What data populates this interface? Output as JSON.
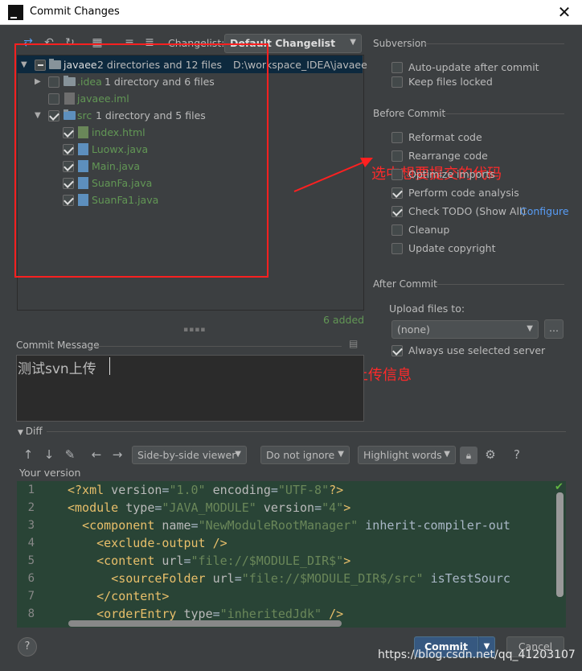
{
  "window": {
    "title": "Commit Changes",
    "close": "✕",
    "app_icon_letter": "IJ"
  },
  "toolbar": {
    "changelist_label": "Changelist:",
    "changelist_value": "Default Changelist"
  },
  "tree": {
    "root": {
      "name": "javaee",
      "detail": "2 directories and 12 files",
      "path": "D:\\workspace_IDEA\\javaee"
    },
    "idea": {
      "name": ".idea",
      "detail": "1 directory and 6 files"
    },
    "iml": {
      "name": "javaee.iml"
    },
    "src": {
      "name": "src",
      "detail": "1 directory and 5 files"
    },
    "files": [
      "index.html",
      "Luowx.java",
      "Main.java",
      "SuanFa.java",
      "SuanFa1.java"
    ],
    "added_count": "6 added"
  },
  "annotations": {
    "select_code": "选中想要提交的代码",
    "write_info": "写上上传信息"
  },
  "commit_message": {
    "label": "Commit Message",
    "value": "测试svn上传"
  },
  "subversion": {
    "title": "Subversion",
    "auto_update": "Auto-update after commit",
    "keep_locked": "Keep files locked"
  },
  "before_commit": {
    "title": "Before Commit",
    "reformat": "Reformat code",
    "rearrange": "Rearrange code",
    "optimize": "Optimize imports",
    "analysis": "Perform code analysis",
    "todo": "Check TODO (Show All)",
    "configure": "Configure",
    "cleanup": "Cleanup",
    "copyright": "Update copyright"
  },
  "after_commit": {
    "title": "After Commit",
    "upload_label": "Upload files to:",
    "upload_value": "(none)",
    "dots": "...",
    "always_use": "Always use selected server"
  },
  "diff": {
    "label": "Diff",
    "viewer": "Side-by-side viewer",
    "ignore": "Do not ignore",
    "highlight": "Highlight words",
    "help": "?",
    "your_version": "Your version",
    "lines": [
      {
        "n": "1",
        "code": "<?xml version=\"1.0\" encoding=\"UTF-8\"?>"
      },
      {
        "n": "2",
        "code": "<module type=\"JAVA_MODULE\" version=\"4\">"
      },
      {
        "n": "3",
        "code": "  <component name=\"NewModuleRootManager\" inherit-compiler-out"
      },
      {
        "n": "4",
        "code": "    <exclude-output />"
      },
      {
        "n": "5",
        "code": "    <content url=\"file://$MODULE_DIR$\">"
      },
      {
        "n": "6",
        "code": "      <sourceFolder url=\"file://$MODULE_DIR$/src\" isTestSourc"
      },
      {
        "n": "7",
        "code": "    </content>"
      },
      {
        "n": "8",
        "code": "    <orderEntry type=\"inheritedJdk\" />"
      }
    ]
  },
  "footer": {
    "help": "?",
    "commit": "Commit",
    "cancel": "Cancel",
    "watermark": "https://blog.csdn.net/qq_41203107"
  }
}
